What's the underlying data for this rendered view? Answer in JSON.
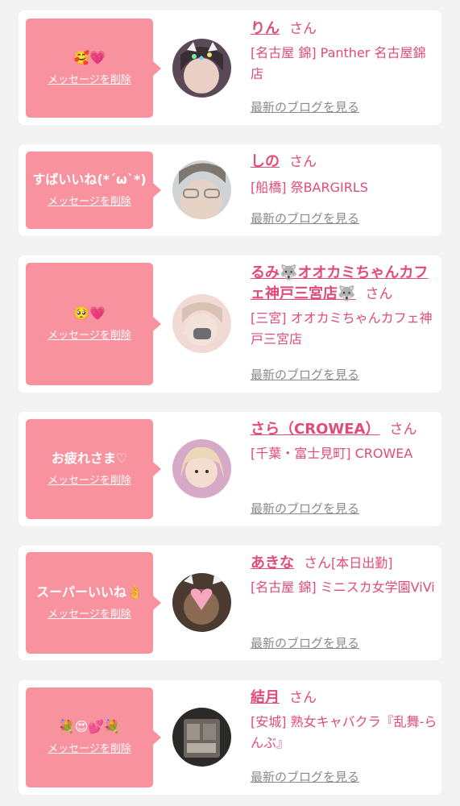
{
  "items": [
    {
      "message": "🥰💗",
      "delete_label": "メッセージを削除",
      "name": "りん",
      "honorific": "さん",
      "shop_area": "[名古屋 錦] Panther 名古屋錦店",
      "blog_label": "最新のブログを見る"
    },
    {
      "message": "すばいいね(*´ω`*)",
      "delete_label": "メッセージを削除",
      "name": "しの",
      "honorific": "さん",
      "shop_area": "[船橋] 祭BARGIRLS",
      "blog_label": "最新のブログを見る"
    },
    {
      "message": "🥺💗",
      "delete_label": "メッセージを削除",
      "name": "るみ🐺オオカミちゃんカフェ神戸三宮店🐺",
      "honorific": "さん",
      "shop_area": "[三宮] オオカミちゃんカフェ神戸三宮店",
      "blog_label": "最新のブログを見る"
    },
    {
      "message": "お疲れさま♡",
      "delete_label": "メッセージを削除",
      "name": "さら（CROWEA）",
      "honorific": "さん",
      "shop_area": "[千葉・富士見町] CROWEA",
      "blog_label": "最新のブログを見る"
    },
    {
      "message": "スーパーいいね👌",
      "delete_label": "メッセージを削除",
      "name": "あきな",
      "honorific": "さん",
      "status_tag": "[本日出勤]",
      "shop_area": "[名古屋 錦] ミニスカ女学園ViVi",
      "blog_label": "最新のブログを見る"
    },
    {
      "message": "💐😍💕💐",
      "delete_label": "メッセージを削除",
      "name": "結月",
      "honorific": "さん",
      "shop_area": "[安城] 熟女キャバクラ『乱舞-らんぶ』",
      "blog_label": "最新のブログを見る"
    }
  ],
  "colors": {
    "page_background": "#f3f3f3",
    "card_background": "#ffffff",
    "bubble_pink": "#f8929e",
    "name_pink": "#e14b78",
    "blog_gray": "#8a8a8a"
  },
  "icons": [
    "avatar-photo"
  ]
}
